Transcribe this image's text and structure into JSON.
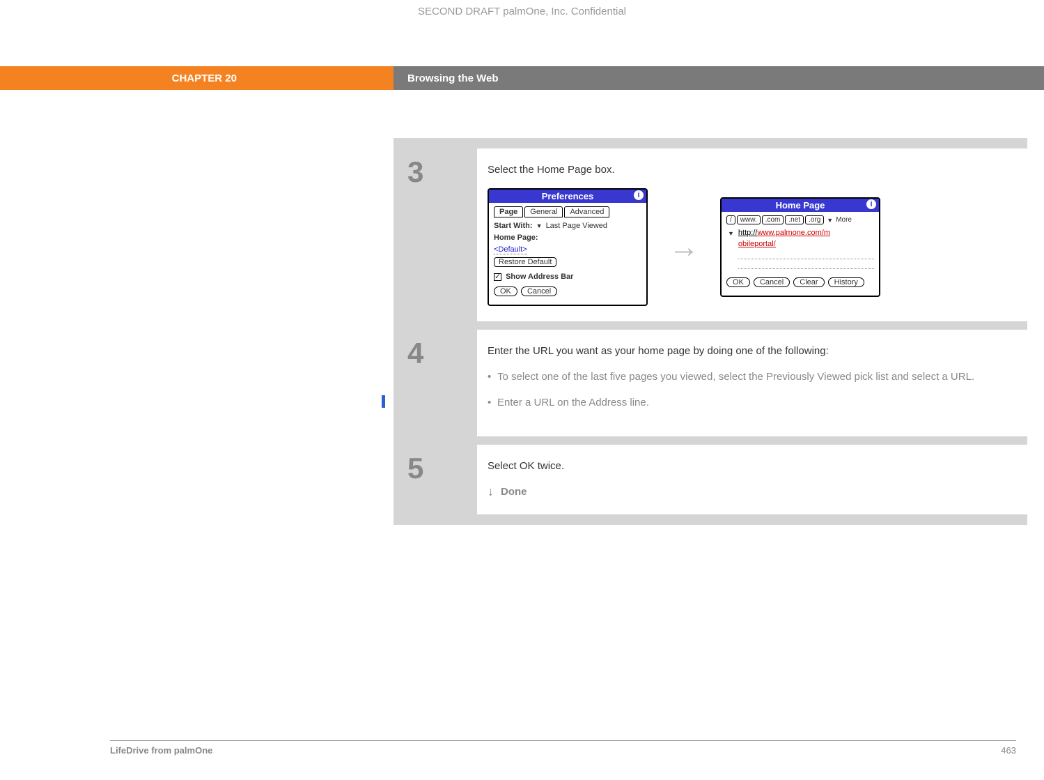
{
  "header": {
    "draft": "SECOND DRAFT palmOne, Inc.  Confidential",
    "chapter": "CHAPTER 20",
    "title": "Browsing the Web"
  },
  "steps": {
    "s3": {
      "number": "3",
      "title": "Select the Home Page box.",
      "prefs": {
        "title": "Preferences",
        "tabs": {
          "page": "Page",
          "general": "General",
          "advanced": "Advanced"
        },
        "start_with_label": "Start With:",
        "start_with_value": "Last Page Viewed",
        "home_page_label": "Home Page:",
        "default_value": "<Default>",
        "restore_default": "Restore Default",
        "show_address": "Show Address Bar",
        "ok": "OK",
        "cancel": "Cancel"
      },
      "homepage": {
        "title": "Home Page",
        "btns": {
          "slash": "/",
          "www": "www.",
          "com": ".com",
          "net": ".net",
          "org": ".org",
          "more": "More"
        },
        "url_a": "http://",
        "url_b": "www.palmone.com/m",
        "url_c": "obileportal/",
        "ok": "OK",
        "cancel": "Cancel",
        "clear": "Clear",
        "history": "History"
      }
    },
    "s4": {
      "number": "4",
      "title": "Enter the URL you want as your home page by doing one of the following:",
      "bullet1": "To select one of the last five pages you viewed, select the Previously Viewed pick list and select a URL.",
      "bullet2": "Enter a URL on the Address line."
    },
    "s5": {
      "number": "5",
      "title": "Select OK twice.",
      "done": "Done"
    }
  },
  "footer": {
    "product": "LifeDrive from palmOne",
    "page": "463"
  }
}
